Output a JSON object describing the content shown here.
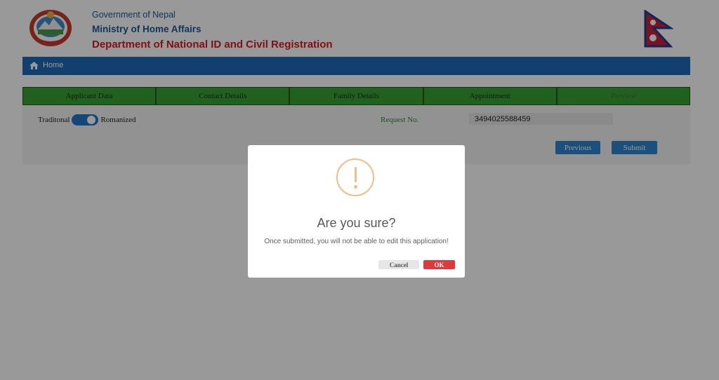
{
  "header": {
    "line1": "Government of Nepal",
    "line2": "Ministry of Home Affairs",
    "line3": "Department of National ID and Civil Registration"
  },
  "navbar": {
    "home_label": "Home"
  },
  "tabs": [
    {
      "label": "Applicant Data"
    },
    {
      "label": "Contact Details"
    },
    {
      "label": "Family Details"
    },
    {
      "label": "Appointment"
    },
    {
      "label": "Preview"
    }
  ],
  "form": {
    "toggle_left": "Traditonal",
    "toggle_right": "Romanized",
    "request_label": "Request No.",
    "request_value": "3494025588459",
    "previous_label": "Previous",
    "submit_label": "Submit"
  },
  "dialog": {
    "title": "Are you sure?",
    "message": "Once submitted, you will not be able to edit this application!",
    "cancel_label": "Cancel",
    "ok_label": "OK"
  },
  "colors": {
    "navbar": "#1e6bb8",
    "tab": "#3aa036",
    "warning": "#f8bb86",
    "ok_button": "#dd3b3b"
  }
}
